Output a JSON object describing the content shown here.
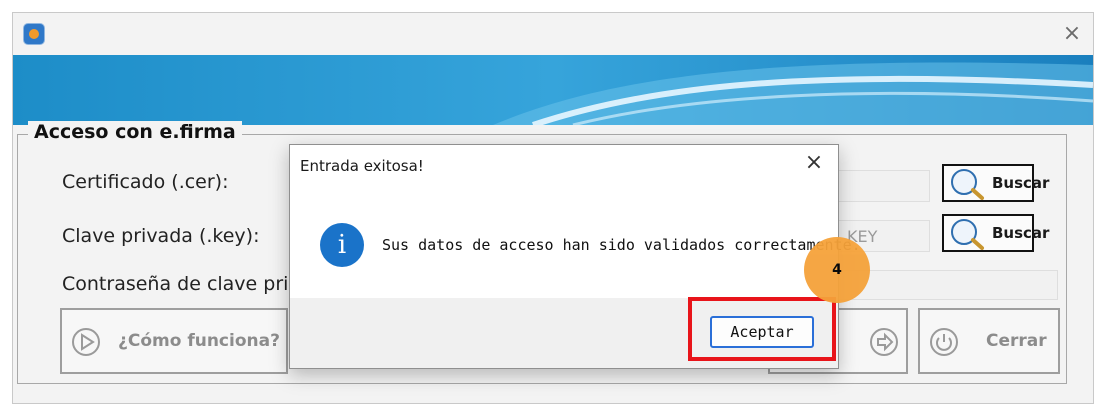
{
  "window": {
    "close_glyph": "×"
  },
  "group": {
    "legend": "Acceso con e.firma"
  },
  "form": {
    "certificado_label": "Certificado (.cer):",
    "clave_label": "Clave privada (.key):",
    "contrasena_label": "Contraseña de clave priva",
    "clave_field_visible_text": "KEY",
    "buscar_cer_label": "Buscar",
    "buscar_key_label": "Buscar"
  },
  "buttons": {
    "como_funciona_label": "¿Cómo funciona?",
    "cerrar_label": "Cerrar"
  },
  "dialog": {
    "title": "Entrada exitosa!",
    "close_glyph": "×",
    "info_glyph": "i",
    "message": "Sus datos de acceso han sido validados correctamente.",
    "accept_label": "Aceptar"
  },
  "annotation": {
    "step_number": "4",
    "highlight_color": "#e8141a",
    "badge_color": "#f5a23a"
  },
  "colors": {
    "banner_blue": "#1e8fc9",
    "accent_blue": "#2a6fd8",
    "info_blue": "#1a73c9"
  },
  "icons": {
    "app": "app-logo-icon",
    "search": "magnifier-icon",
    "play": "play-circle-icon",
    "arrow": "arrow-circle-icon",
    "power": "power-icon",
    "info": "info-icon"
  }
}
